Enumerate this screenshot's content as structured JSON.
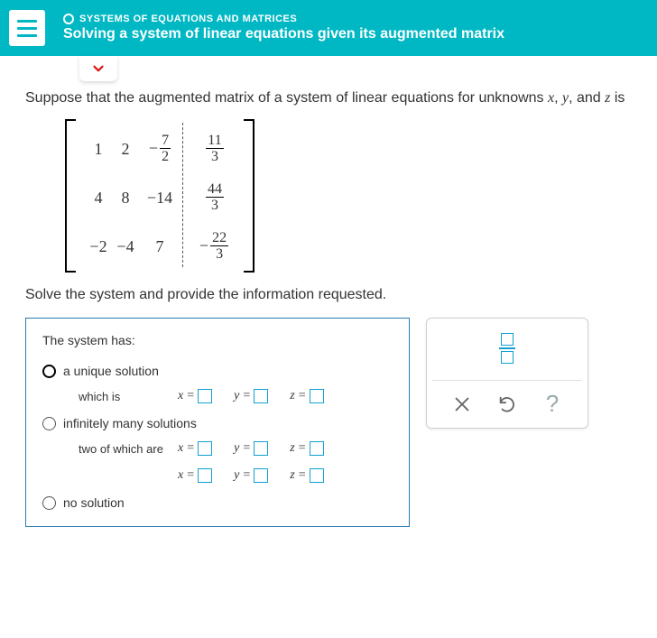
{
  "header": {
    "breadcrumb": "SYSTEMS OF EQUATIONS AND MATRICES",
    "title": "Solving a system of linear equations given its augmented matrix"
  },
  "intro": {
    "prefix": "Suppose that the augmented matrix of a system of linear equations for unknowns ",
    "var_x": "x",
    "var_y": "y",
    "var_z": "z",
    "sep1": ", ",
    "sep2": ", and ",
    "suffix": " is"
  },
  "matrix": {
    "r1": {
      "c1": "1",
      "c2": "2",
      "c3_num": "7",
      "c3_den": "2",
      "c3_neg": "−",
      "aug_num": "11",
      "aug_den": "3",
      "aug_neg": ""
    },
    "r2": {
      "c1": "4",
      "c2": "8",
      "c3": "−14",
      "aug_num": "44",
      "aug_den": "3",
      "aug_neg": ""
    },
    "r3": {
      "c1": "−2",
      "c2": "−4",
      "c3": "7",
      "aug_num": "22",
      "aug_den": "3",
      "aug_neg": "−"
    }
  },
  "instruction": "Solve the system and provide the information requested.",
  "answer": {
    "heading": "The system has:",
    "opt_unique": "a unique solution",
    "which_is": "which is",
    "opt_infinite": "infinitely many solutions",
    "two_of_which": "two of which are",
    "opt_none": "no solution",
    "x_eq": "x",
    "y_eq": "y",
    "z_eq": "z",
    "eq_sign": "="
  },
  "tools": {
    "help": "?"
  }
}
